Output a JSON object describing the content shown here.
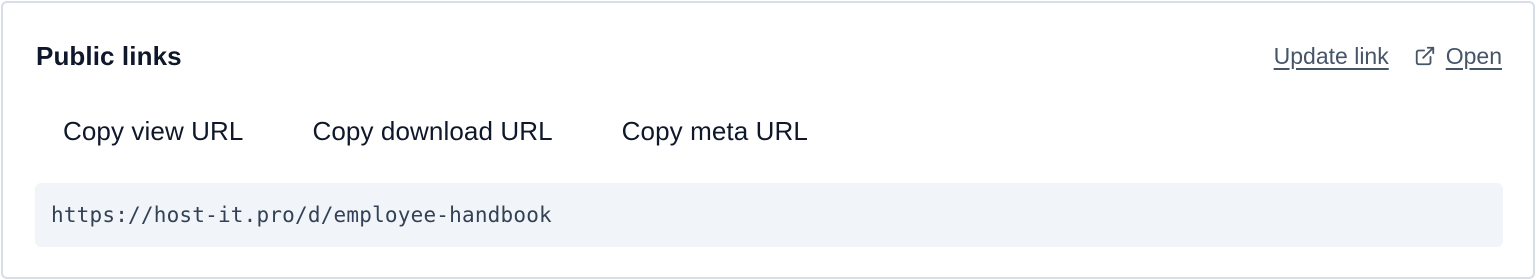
{
  "card": {
    "title": "Public links"
  },
  "header_actions": {
    "update_label": "Update link",
    "open_label": "Open",
    "open_icon": "external-link-icon"
  },
  "copy_buttons": [
    {
      "label": "Copy view URL"
    },
    {
      "label": "Copy download URL"
    },
    {
      "label": "Copy meta URL"
    }
  ],
  "url_display": {
    "value": "https://host-it.pro/d/employee-handbook"
  },
  "colors": {
    "border": "#d8dee8",
    "title_text": "#0f172a",
    "link_text": "#475569",
    "url_background": "#f1f5f9",
    "url_text": "#334155"
  }
}
